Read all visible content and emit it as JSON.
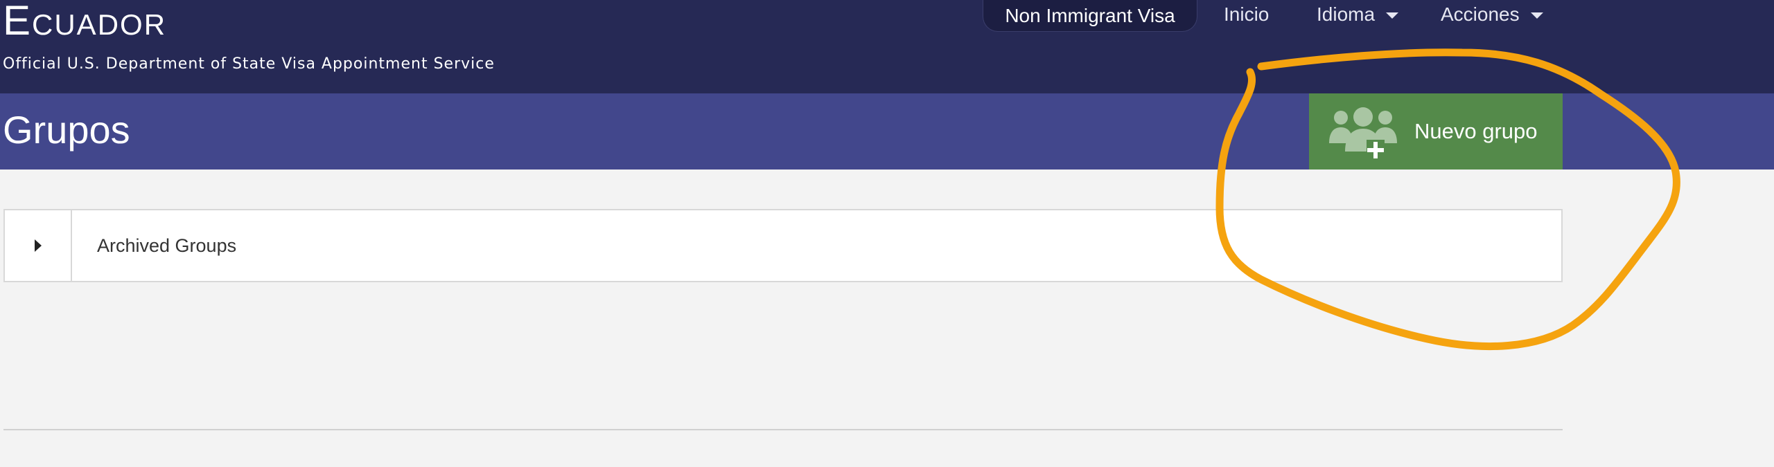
{
  "header": {
    "brand_title": "Ecuador",
    "brand_subtitle": "Official U.S. Department of State Visa Appointment Service",
    "nav": {
      "visa_type": "Non Immigrant Visa",
      "home": "Inicio",
      "language": "Idioma",
      "actions": "Acciones"
    }
  },
  "page": {
    "title": "Grupos",
    "new_group_label": "Nuevo grupo"
  },
  "archived": {
    "label": "Archived Groups"
  },
  "icons": {
    "new_group": "group-add-icon",
    "expand": "caret-right-icon",
    "dropdown": "caret-down-icon"
  },
  "colors": {
    "topbar": "#262955",
    "pagebar": "#42478c",
    "new_group_button": "#548a4a",
    "annotation": "#f5a30f",
    "background": "#f3f3f3"
  }
}
